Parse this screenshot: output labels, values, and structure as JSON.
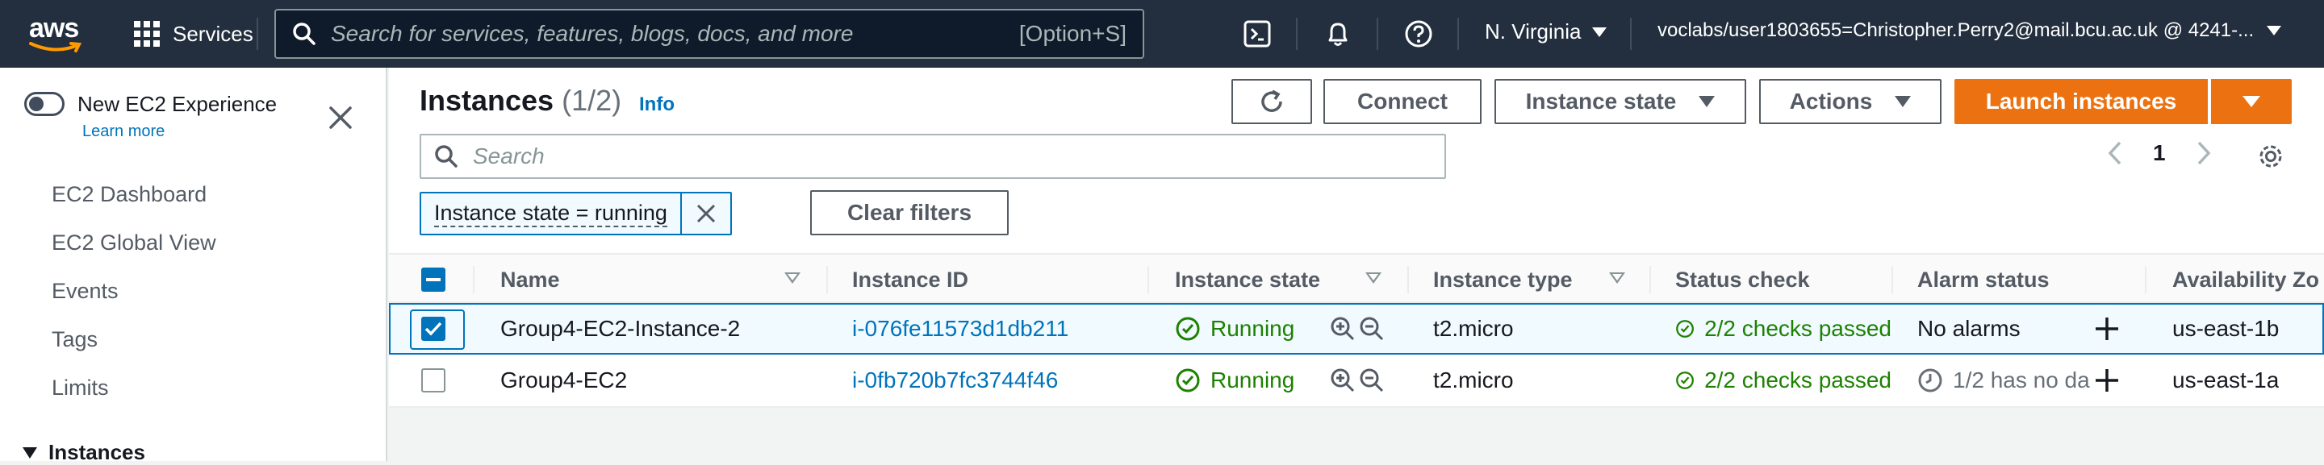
{
  "nav": {
    "logo_text": "aws",
    "services_label": "Services",
    "search_placeholder": "Search for services, features, blogs, docs, and more",
    "search_shortcut": "[Option+S]",
    "region": "N. Virginia",
    "account": "voclabs/user1803655=Christopher.Perry2@mail.bcu.ac.uk @ 4241-..."
  },
  "sidebar": {
    "new_experience": "New EC2 Experience",
    "learn_more": "Learn more",
    "items": [
      "EC2 Dashboard",
      "EC2 Global View",
      "Events",
      "Tags",
      "Limits"
    ],
    "section_instances": "Instances"
  },
  "header": {
    "title": "Instances",
    "count": "(1/2)",
    "info": "Info",
    "connect": "Connect",
    "instance_state": "Instance state",
    "actions": "Actions",
    "launch": "Launch instances"
  },
  "filter": {
    "placeholder": "Search",
    "token": "Instance state = running",
    "clear": "Clear filters",
    "page": "1"
  },
  "table": {
    "columns": [
      "Name",
      "Instance ID",
      "Instance state",
      "Instance type",
      "Status check",
      "Alarm status",
      "Availability Zo"
    ],
    "rows": [
      {
        "selected": true,
        "name": "Group4-EC2-Instance-2",
        "id": "i-076fe11573d1db211",
        "state": "Running",
        "type": "t2.micro",
        "status": "2/2 checks passed",
        "alarm": "No alarms",
        "az": "us-east-1b"
      },
      {
        "selected": false,
        "name": "Group4-EC2",
        "id": "i-0fb720b7fc3744f46",
        "state": "Running",
        "type": "t2.micro",
        "status": "2/2 checks passed",
        "alarm": "1/2 has no da",
        "az": "us-east-1a"
      }
    ]
  },
  "colors": {
    "nav_bg": "#232f3e",
    "primary": "#ec7211",
    "link": "#0073bb",
    "success": "#1d8102"
  }
}
